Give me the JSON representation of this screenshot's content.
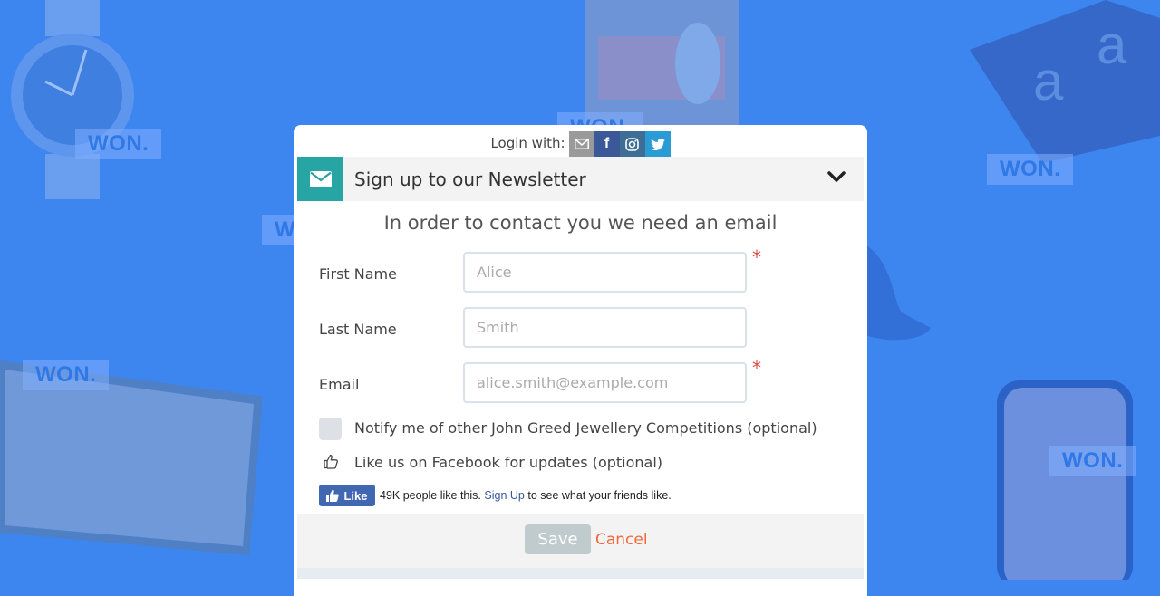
{
  "background": {
    "won_badges": [
      "WON.",
      "WON.",
      "WON.",
      "WON.",
      "WON.",
      "WON.",
      "WON."
    ],
    "accent": "#3d86f0"
  },
  "modal": {
    "login_with": "Login with:",
    "social_icons": [
      "envelope-icon",
      "facebook-icon",
      "instagram-icon",
      "twitter-icon"
    ],
    "header_title": "Sign up to our Newsletter",
    "intro": "In order to contact you we need an email",
    "fields": {
      "first_name": {
        "label": "First Name",
        "placeholder": "Alice",
        "required": "*"
      },
      "last_name": {
        "label": "Last Name",
        "placeholder": "Smith"
      },
      "email": {
        "label": "Email",
        "placeholder": "alice.smith@example.com",
        "required": "*"
      }
    },
    "notify_label": "Notify me of other John Greed Jewellery Competitions (optional)",
    "like_label": "Like us on Facebook for updates (optional)",
    "facebook": {
      "button": "Like",
      "count_text": "49K people like this.",
      "signup_link": "Sign Up",
      "suffix": "to see what your friends like."
    },
    "save": "Save",
    "cancel": "Cancel",
    "colors": {
      "header_icon": "#26a5a4",
      "cancel": "#f0693c",
      "required": "#e04545"
    }
  }
}
